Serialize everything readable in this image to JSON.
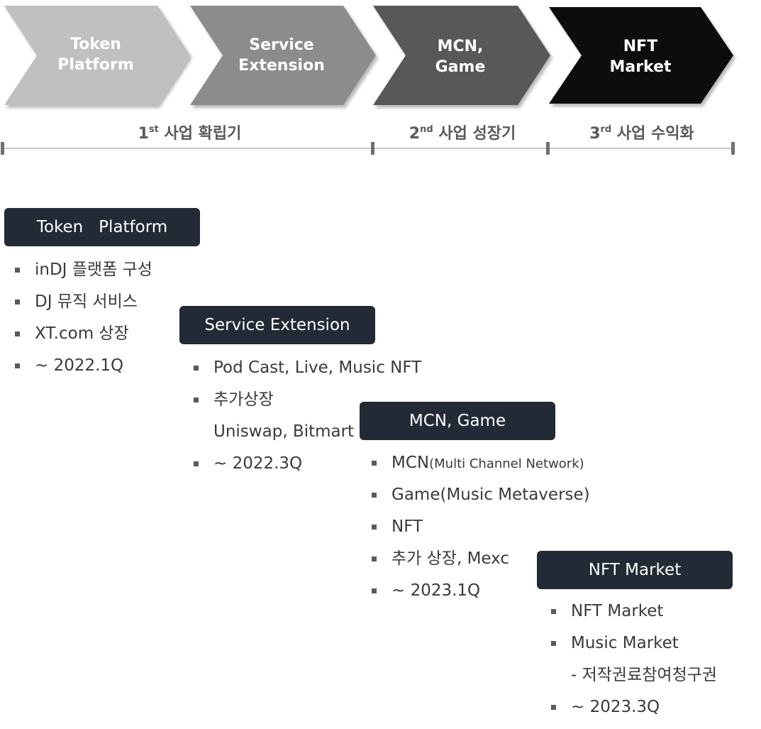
{
  "stages": [
    {
      "label": "Token\nPlatform",
      "color": "#c0c0c0"
    },
    {
      "label": "Service\nExtension",
      "color": "#8c8c8c"
    },
    {
      "label": "MCN,\nGame",
      "color": "#595959"
    },
    {
      "label": "NFT\nMarket",
      "color": "#0d0d0d"
    }
  ],
  "phases": [
    {
      "num": "1",
      "sup": "st",
      "text": "사업 확립기"
    },
    {
      "num": "2",
      "sup": "nd",
      "text": "사업 성장기"
    },
    {
      "num": "3",
      "sup": "rd",
      "text": "사업 수익화"
    }
  ],
  "sections": [
    {
      "title": "Token   Platform",
      "items": [
        {
          "text": "inDJ 플랫폼 구성"
        },
        {
          "text": "DJ 뮤직 서비스"
        },
        {
          "text": "XT.com 상장"
        },
        {
          "text": "~ 2022.1Q"
        }
      ]
    },
    {
      "title": "Service Extension",
      "items": [
        {
          "text": "Pod Cast, Live, Music NFT"
        },
        {
          "text": "추가상장"
        },
        {
          "text": "Uniswap,  Bitmart",
          "sub": true
        },
        {
          "text": "~ 2022.3Q"
        }
      ]
    },
    {
      "title": "MCN, Game",
      "items": [
        {
          "text": "MCN",
          "small": "(Multi Channel Network)"
        },
        {
          "text": "Game(Music Metaverse)"
        },
        {
          "text": "NFT"
        },
        {
          "text": "추가 상장, Mexc"
        },
        {
          "text": "~ 2023.1Q"
        }
      ]
    },
    {
      "title": "NFT Market",
      "items": [
        {
          "text": "NFT Market"
        },
        {
          "text": "Music Market"
        },
        {
          "text": "- 저작권료참여청구권",
          "sub": true
        },
        {
          "text": "~ 2023.3Q"
        }
      ]
    }
  ]
}
